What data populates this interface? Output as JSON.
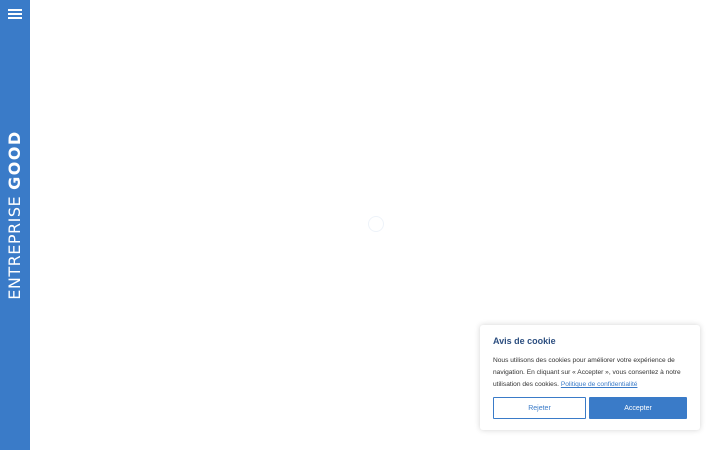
{
  "sidebar": {
    "menu_icon": "hamburger-menu-icon",
    "logo": {
      "word1": "ENTREPRISE",
      "word2": "GOOD"
    }
  },
  "main": {
    "loading_icon": "loading-spinner-icon"
  },
  "cookie_banner": {
    "title": "Avis de cookie",
    "text": "Nous utilisons des cookies pour améliorer votre expérience de navigation. En cliquant sur « Accepter », vous consentez à notre utilisation des cookies.",
    "privacy_link": "Politique de confidentialité",
    "reject_label": "Rejeter",
    "accept_label": "Accepter"
  },
  "colors": {
    "brand": "#3a7bc8",
    "title": "#2d4f80",
    "background": "#ffffff"
  }
}
